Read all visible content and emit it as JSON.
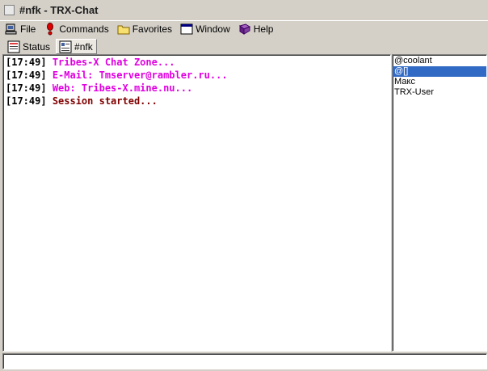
{
  "window": {
    "title": "#nfk - TRX-Chat"
  },
  "menu": {
    "items": [
      {
        "label": "File",
        "icon": "computer-icon"
      },
      {
        "label": "Commands",
        "icon": "exclamation-icon"
      },
      {
        "label": "Favorites",
        "icon": "folder-icon"
      },
      {
        "label": "Window",
        "icon": "window-icon"
      },
      {
        "label": "Help",
        "icon": "book-icon"
      }
    ]
  },
  "tabs": [
    {
      "label": "Status",
      "icon": "status-icon",
      "active": false
    },
    {
      "label": "#nfk",
      "icon": "channel-icon",
      "active": true
    }
  ],
  "chat": {
    "lines": [
      {
        "time": "[17:49]",
        "text": "Tribes-X Chat Zone...",
        "color": "#e000e0"
      },
      {
        "time": "[17:49]",
        "text": "E-Mail: Tmserver@rambler.ru...",
        "color": "#e000e0"
      },
      {
        "time": "[17:49]",
        "text": "Web: Tribes-X.mine.nu...",
        "color": "#e000e0"
      },
      {
        "time": "[17:49]",
        "text": "Session started...",
        "color": "#800000"
      }
    ]
  },
  "users": [
    {
      "name": "@coolant",
      "selected": false
    },
    {
      "name": "@[]",
      "selected": true
    },
    {
      "name": "Макс",
      "selected": false
    },
    {
      "name": "TRX-User",
      "selected": false
    }
  ],
  "input": {
    "value": ""
  },
  "colors": {
    "selection": "#316ac5",
    "chrome": "#d4d0c8"
  }
}
